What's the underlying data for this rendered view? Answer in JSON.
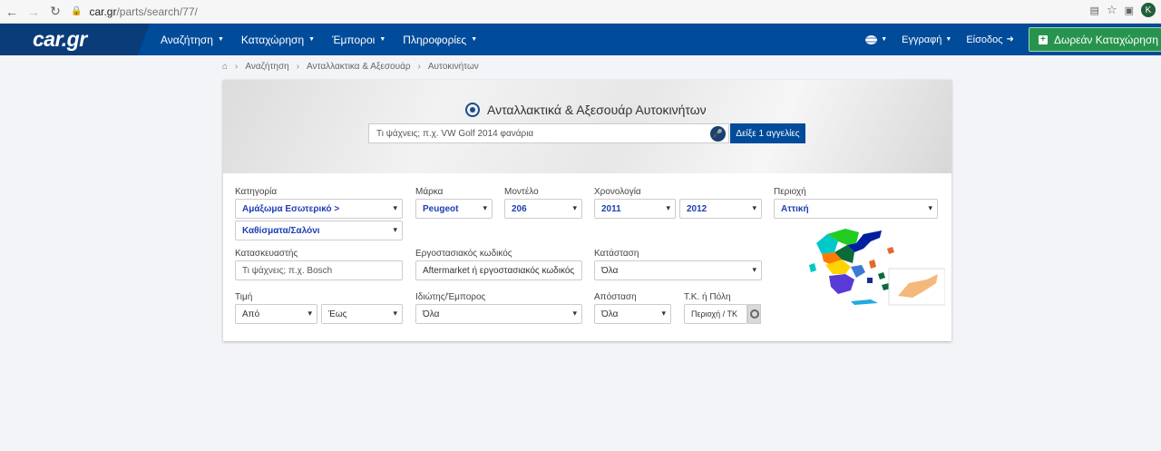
{
  "browser": {
    "url_host": "car.gr",
    "url_path": "/parts/search/77/",
    "profile_initial": "K"
  },
  "header": {
    "logo": "car.gr",
    "nav": [
      {
        "label": "Αναζήτηση"
      },
      {
        "label": "Καταχώρηση"
      },
      {
        "label": "Έμποροι"
      },
      {
        "label": "Πληροφορίες"
      }
    ],
    "register_label": "Εγγραφή",
    "login_label": "Είσοδος",
    "free_listing_label": "Δωρεάν Καταχώρηση"
  },
  "breadcrumb": {
    "items": [
      "Αναζήτηση",
      "Ανταλλακτικα & Αξεσουάρ",
      "Αυτοκινήτων"
    ]
  },
  "hero": {
    "title": "Ανταλλακτικά & Αξεσουάρ Αυτοκινήτων",
    "search_placeholder": "Τι ψάχνεις; π.χ. VW Golf 2014 φανάρια",
    "search_button": "Δείξε 1 αγγελίες"
  },
  "filters": {
    "category": {
      "label": "Κατηγορία",
      "value": "Αμάξωμα Εσωτερικό >",
      "subvalue": "Καθίσματα/Σαλόνι"
    },
    "make": {
      "label": "Μάρκα",
      "value": "Peugeot"
    },
    "model": {
      "label": "Μοντέλο",
      "value": "206"
    },
    "year": {
      "label": "Χρονολογία",
      "from": "2011",
      "to": "2012"
    },
    "region": {
      "label": "Περιοχή",
      "value": "Αττική"
    },
    "manufacturer": {
      "label": "Κατασκευαστής",
      "placeholder": "Τι ψάχνεις; π.χ. Bosch"
    },
    "factory_code": {
      "label": "Εργοστασιακός κωδικός",
      "placeholder": "Aftermarket ή εργοστασιακός κωδικός"
    },
    "condition": {
      "label": "Κατάσταση",
      "value": "Όλα"
    },
    "price": {
      "label": "Τιμή",
      "from": "Από",
      "to": "Έως"
    },
    "seller": {
      "label": "Ιδιώτης/Έμπορος",
      "value": "Όλα"
    },
    "distance": {
      "label": "Απόσταση",
      "value": "Όλα"
    },
    "postcode": {
      "label": "Τ.Κ. ή Πόλη",
      "placeholder": "Περιοχή / ΤΚ"
    }
  },
  "colors": {
    "brand_blue": "#004b9a",
    "accent_green": "#27944e",
    "value_blue": "#1d3fb4"
  },
  "icons": [
    "back-arrow-icon",
    "forward-arrow-icon",
    "reload-icon",
    "lock-icon",
    "translate-icon",
    "star-icon",
    "camera-icon",
    "home-icon",
    "tools-icon",
    "microphone-icon",
    "locate-icon",
    "map-greece-icon"
  ]
}
